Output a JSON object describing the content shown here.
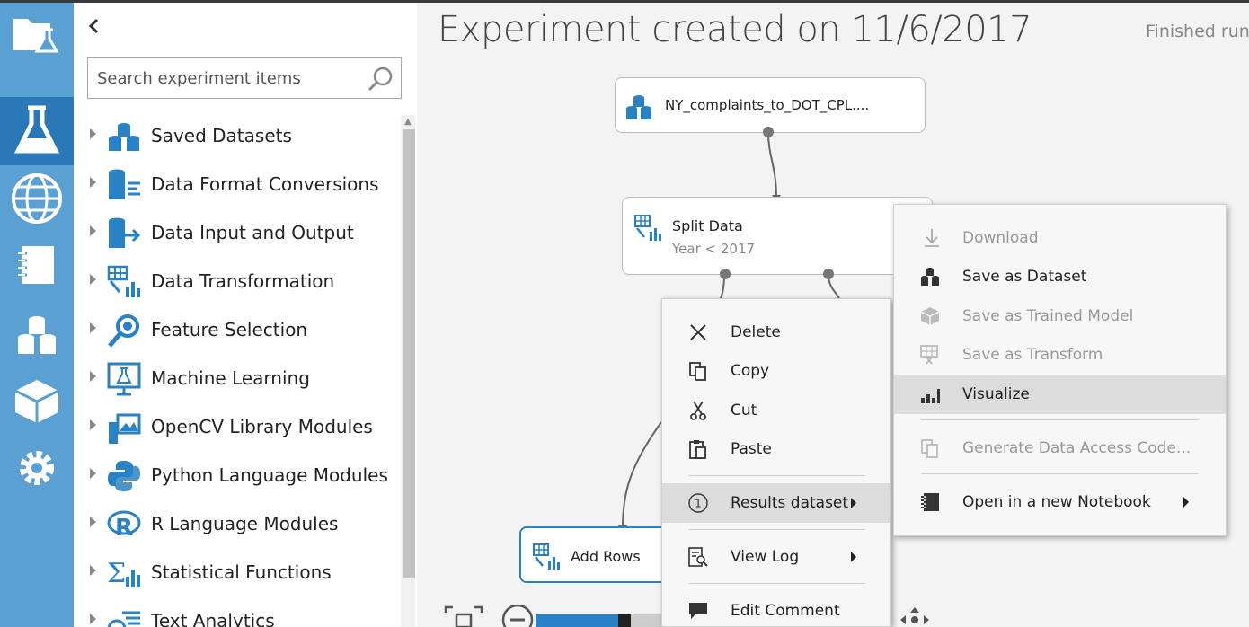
{
  "rail": {
    "items": [
      {
        "name": "projects",
        "icon": "folder-flask-icon"
      },
      {
        "name": "experiments",
        "icon": "flask-icon",
        "active": true
      },
      {
        "name": "web-services",
        "icon": "globe-icon"
      },
      {
        "name": "notebooks",
        "icon": "notebook-icon"
      },
      {
        "name": "datasets",
        "icon": "datasets-icon"
      },
      {
        "name": "trained-models",
        "icon": "cube-icon"
      },
      {
        "name": "settings",
        "icon": "gear-icon"
      }
    ]
  },
  "palette": {
    "search_placeholder": "Search experiment items",
    "categories": [
      {
        "label": "Saved Datasets",
        "icon": "datasets-icon"
      },
      {
        "label": "Data Format Conversions",
        "icon": "format-conversion-icon"
      },
      {
        "label": "Data Input and Output",
        "icon": "data-io-icon"
      },
      {
        "label": "Data Transformation",
        "icon": "data-transformation-icon"
      },
      {
        "label": "Feature Selection",
        "icon": "feature-selection-icon"
      },
      {
        "label": "Machine Learning",
        "icon": "machine-learning-icon"
      },
      {
        "label": "OpenCV Library Modules",
        "icon": "opencv-icon"
      },
      {
        "label": "Python Language Modules",
        "icon": "python-icon"
      },
      {
        "label": "R Language Modules",
        "icon": "r-language-icon"
      },
      {
        "label": "Statistical Functions",
        "icon": "statistics-icon"
      },
      {
        "label": "Text Analytics",
        "icon": "text-analytics-icon"
      }
    ]
  },
  "experiment": {
    "title": "Experiment created on 11/6/2017",
    "status": "Finished runn"
  },
  "modules": {
    "dataset": {
      "name": "NY_complaints_to_DOT_CPL...."
    },
    "split": {
      "name": "Split Data",
      "subtitle": "Year < 2017"
    },
    "add_rows": {
      "name": "Add Rows"
    }
  },
  "context_menu": {
    "items": [
      {
        "label": "Delete",
        "icon": "delete-x-icon"
      },
      {
        "label": "Copy",
        "icon": "copy-icon"
      },
      {
        "label": "Cut",
        "icon": "scissors-icon"
      },
      {
        "label": "Paste",
        "icon": "paste-icon"
      },
      {
        "label": "Results dataset",
        "icon": "port-1-icon",
        "submenu": true,
        "hovered": true
      },
      {
        "label": "View Log",
        "icon": "view-log-icon",
        "submenu": true
      },
      {
        "label": "Edit Comment",
        "icon": "comment-icon"
      }
    ]
  },
  "submenu": {
    "items": [
      {
        "label": "Download",
        "icon": "download-icon",
        "disabled": true
      },
      {
        "label": "Save as Dataset",
        "icon": "datasets-icon",
        "disabled": false
      },
      {
        "label": "Save as Trained Model",
        "icon": "cube-icon",
        "disabled": true
      },
      {
        "label": "Save as Transform",
        "icon": "transform-icon",
        "disabled": true
      },
      {
        "label": "Visualize",
        "icon": "bar-chart-icon",
        "disabled": false,
        "hovered": true
      },
      {
        "label": "Generate Data Access Code...",
        "icon": "copy-icon",
        "disabled": true
      },
      {
        "label": "Open in a new Notebook",
        "icon": "notebook-icon",
        "disabled": false,
        "submenu": true
      }
    ]
  },
  "colors": {
    "rail": "#5aa0d3",
    "rail_active": "#2a78b8",
    "module_icon": "#2a82c6",
    "menu_hover": "#dcdcdc",
    "selected_border": "#2a82c6"
  }
}
